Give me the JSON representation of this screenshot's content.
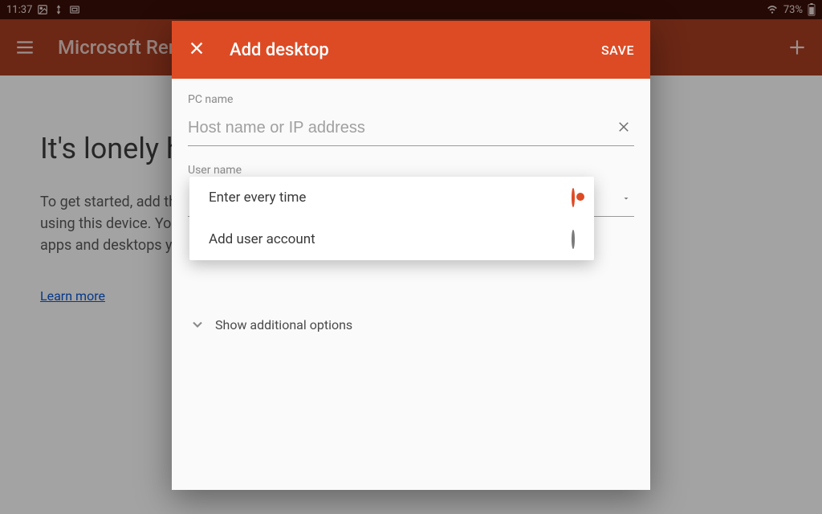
{
  "status": {
    "time": "11:37",
    "battery": "73%"
  },
  "app": {
    "title": "Microsoft Remote Desktop"
  },
  "background": {
    "heading": "It's lonely here.",
    "paragraph": "To get started, add the remote desktop that you want to connect to using this device. You can also add remote resources to work with apps and desktops your administrator has set up for you.",
    "link_text": "Learn more"
  },
  "dialog": {
    "title": "Add desktop",
    "save": "SAVE",
    "pc_name_label": "PC name",
    "pc_name_placeholder": "Host name or IP address",
    "user_name_label": "User name",
    "show_more": "Show additional options",
    "options": {
      "enter_every_time": "Enter every time",
      "add_user": "Add user account"
    }
  }
}
